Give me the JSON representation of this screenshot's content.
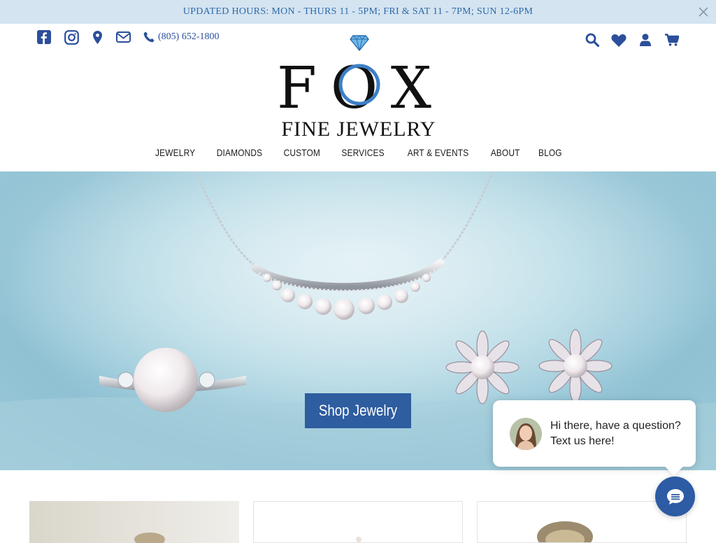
{
  "announcement": {
    "text": "UPDATED HOURS: MON - THURS 11 - 5PM; FRI & SAT 11 - 7PM; SUN 12-6PM"
  },
  "contact": {
    "phone": "(805) 652-1800"
  },
  "logo": {
    "main": "FOX",
    "sub": "FINE JEWELRY"
  },
  "nav": {
    "items": [
      {
        "label": "JEWELRY"
      },
      {
        "label": "DIAMONDS"
      },
      {
        "label": "CUSTOM"
      },
      {
        "label": "SERVICES"
      },
      {
        "label": "ART & EVENTS"
      },
      {
        "label": "ABOUT"
      },
      {
        "label": "BLOG"
      }
    ]
  },
  "hero": {
    "cta": "Shop Jewelry"
  },
  "chat": {
    "message": "Hi there, have a question? Text us here!"
  },
  "colors": {
    "brand": "#2e5da0",
    "announce_bg": "#d4e4f1",
    "icon": "#2b4f9a"
  },
  "icons": [
    "facebook-icon",
    "instagram-icon",
    "map-pin-icon",
    "envelope-icon",
    "phone-icon",
    "search-icon",
    "heart-icon",
    "user-icon",
    "cart-icon",
    "close-icon",
    "chat-icon"
  ]
}
